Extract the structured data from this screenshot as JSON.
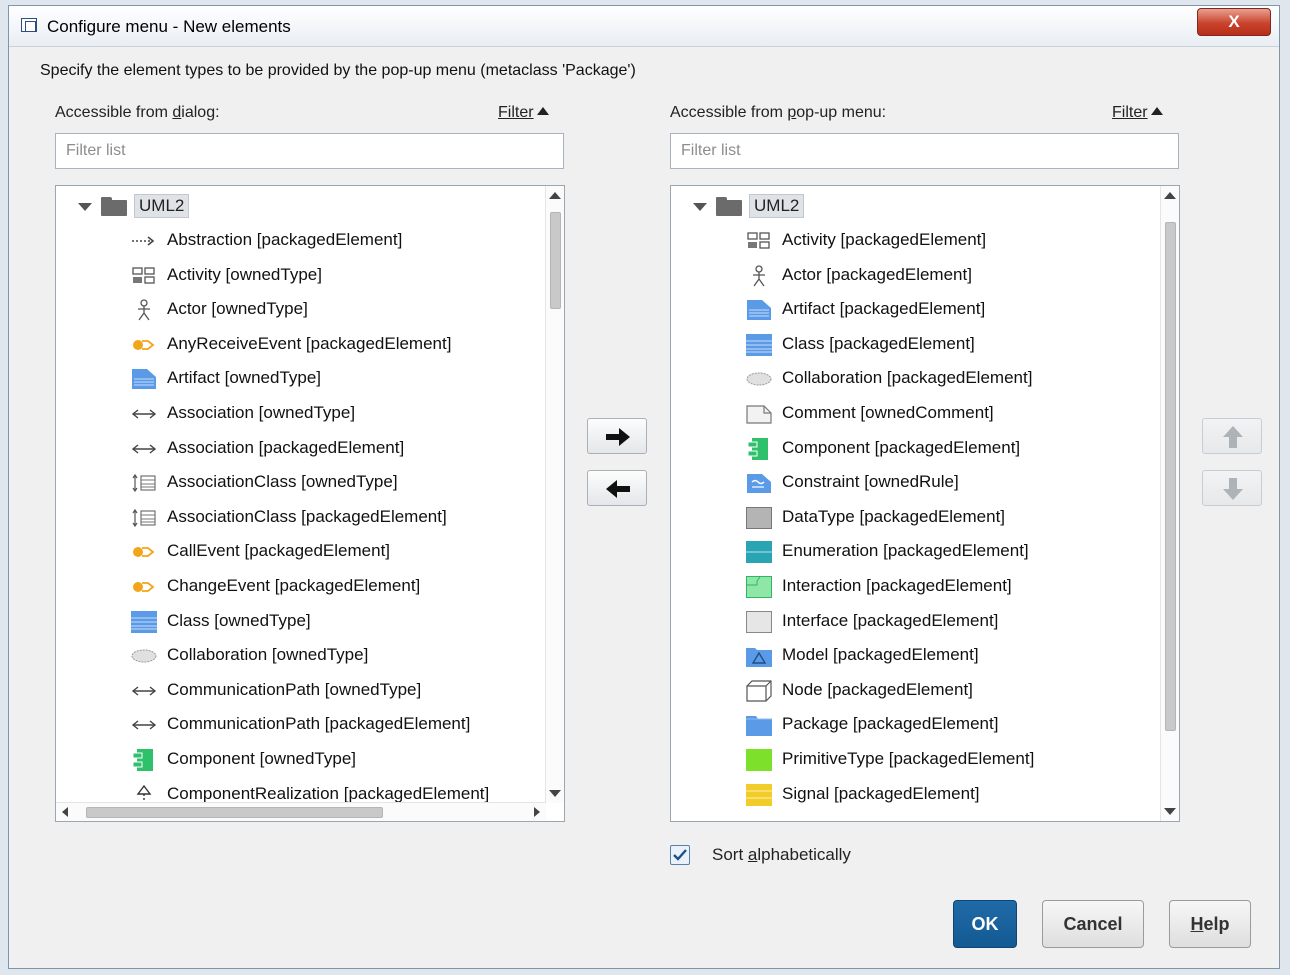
{
  "window": {
    "title": "Configure menu - New elements",
    "close_glyph": "X"
  },
  "instruction": "Specify the element types to be provided by the pop-up menu (metaclass 'Package')",
  "left_panel": {
    "label_prefix": "Accessible from ",
    "label_mnemonic": "d",
    "label_suffix": "ialog:",
    "filter_link": "Filter",
    "filter_placeholder": "Filter list",
    "root": "UML2",
    "items": [
      {
        "icon": "dependency-arrow-icon",
        "label": "Abstraction [packagedElement]"
      },
      {
        "icon": "activity-icon",
        "label": "Activity [ownedType]"
      },
      {
        "icon": "actor-icon",
        "label": "Actor [ownedType]"
      },
      {
        "icon": "event-icon",
        "label": "AnyReceiveEvent [packagedElement]"
      },
      {
        "icon": "artifact-icon",
        "label": "Artifact [ownedType]"
      },
      {
        "icon": "association-icon",
        "label": "Association [ownedType]"
      },
      {
        "icon": "association-icon",
        "label": "Association [packagedElement]"
      },
      {
        "icon": "association-class-icon",
        "label": "AssociationClass [ownedType]"
      },
      {
        "icon": "association-class-icon",
        "label": "AssociationClass [packagedElement]"
      },
      {
        "icon": "event-icon",
        "label": "CallEvent [packagedElement]"
      },
      {
        "icon": "event-icon",
        "label": "ChangeEvent [packagedElement]"
      },
      {
        "icon": "class-icon",
        "label": "Class [ownedType]"
      },
      {
        "icon": "collaboration-icon",
        "label": "Collaboration [ownedType]"
      },
      {
        "icon": "association-icon",
        "label": "CommunicationPath [ownedType]"
      },
      {
        "icon": "association-icon",
        "label": "CommunicationPath [packagedElement]"
      },
      {
        "icon": "component-icon",
        "label": "Component [ownedType]"
      },
      {
        "icon": "realization-icon",
        "label": "ComponentRealization [packagedElement]"
      }
    ]
  },
  "right_panel": {
    "label_prefix": "Accessible from ",
    "label_mnemonic": "p",
    "label_suffix": "op-up menu:",
    "filter_link": "Filter",
    "filter_placeholder": "Filter list",
    "root": "UML2",
    "items": [
      {
        "icon": "activity-icon",
        "label": "Activity [packagedElement]"
      },
      {
        "icon": "actor-icon",
        "label": "Actor [packagedElement]"
      },
      {
        "icon": "artifact-icon",
        "label": "Artifact [packagedElement]"
      },
      {
        "icon": "class-icon",
        "label": "Class [packagedElement]"
      },
      {
        "icon": "collaboration-icon",
        "label": "Collaboration [packagedElement]"
      },
      {
        "icon": "comment-icon",
        "label": "Comment [ownedComment]"
      },
      {
        "icon": "component-icon",
        "label": "Component [packagedElement]"
      },
      {
        "icon": "constraint-icon",
        "label": "Constraint [ownedRule]"
      },
      {
        "icon": "datatype-icon",
        "label": "DataType [packagedElement]"
      },
      {
        "icon": "enumeration-icon",
        "label": "Enumeration [packagedElement]"
      },
      {
        "icon": "interaction-icon",
        "label": "Interaction [packagedElement]"
      },
      {
        "icon": "interface-icon",
        "label": "Interface [packagedElement]"
      },
      {
        "icon": "model-icon",
        "label": "Model [packagedElement]"
      },
      {
        "icon": "node-icon",
        "label": "Node [packagedElement]"
      },
      {
        "icon": "package-icon",
        "label": "Package [packagedElement]"
      },
      {
        "icon": "primitive-type-icon",
        "label": "PrimitiveType [packagedElement]"
      },
      {
        "icon": "signal-icon",
        "label": "Signal [packagedElement]"
      }
    ]
  },
  "sort": {
    "checked": true,
    "label_prefix": "Sort ",
    "label_mnemonic": "a",
    "label_suffix": "lphabetically"
  },
  "buttons": {
    "ok": "OK",
    "cancel": "Cancel",
    "help_mnemonic": "H",
    "help_suffix": "elp"
  },
  "colors": {
    "ok_button": "#1a639f",
    "class_blue": "#5a9ae6",
    "component_green": "#2fc06b",
    "primitive_green": "#7de02a",
    "signal_yellow": "#f2cc2b",
    "event_orange": "#f2a51a"
  }
}
